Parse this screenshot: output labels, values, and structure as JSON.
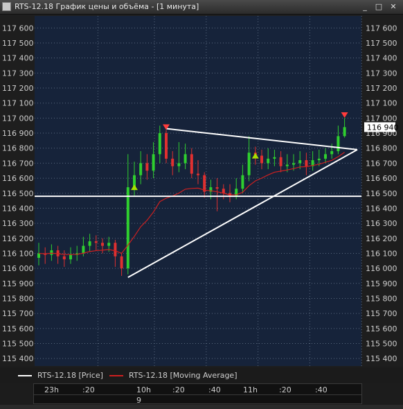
{
  "window": {
    "title": "RTS-12.18 График цены и объёма - [1 минута]",
    "buttons": {
      "minimize": "_",
      "maximize": "□",
      "close": "✕"
    }
  },
  "colors": {
    "background": "#1e1e1e",
    "plot_bg": "#16233a",
    "grid": "#5a6a80",
    "up_bar": "#2fcf2f",
    "down_bar": "#e03030",
    "moving_average": "#d02020",
    "price_line": "#ffffff",
    "up_marker": "#a8e000",
    "down_marker": "#ff3b3b"
  },
  "legend": {
    "price": "RTS-12.18 [Price]",
    "moving_average": "RTS-12.18 [Moving Average]"
  },
  "time_axis": {
    "ticks": [
      "23h",
      ":20",
      "10h",
      ":20",
      ":40",
      "11h",
      ":20",
      ":40"
    ],
    "date": "9"
  },
  "chart_data": {
    "type": "candlestick",
    "title": "",
    "ylim": [
      115350,
      117680
    ],
    "y_ticks": [
      115400,
      115500,
      115600,
      115700,
      115800,
      115900,
      116000,
      116100,
      116200,
      116300,
      116400,
      116500,
      116600,
      116700,
      116800,
      116900,
      117000,
      117100,
      117200,
      117300,
      117400,
      117500,
      117600
    ],
    "y_tick_labels": [
      "115 400",
      "115 500",
      "115 600",
      "115 700",
      "115 800",
      "115 900",
      "116 000",
      "116 100",
      "116 200",
      "116 300",
      "116 400",
      "116 500",
      "116 600",
      "116 700",
      "116 800",
      "116 900",
      "117 000",
      "117 100",
      "117 200",
      "117 300",
      "117 400",
      "117 500",
      "117 600"
    ],
    "last_price": 116940,
    "last_price_label": "116 940",
    "grid": true,
    "horizontal_level": 116480,
    "trendlines": [
      {
        "from": [
          14,
          115940
        ],
        "to": [
          50,
          116790
        ]
      },
      {
        "from": [
          20,
          116930
        ],
        "to": [
          50,
          116790
        ]
      }
    ],
    "up_markers": [
      [
        15,
        116540
      ],
      [
        34,
        116750
      ]
    ],
    "down_markers": [
      [
        20,
        116940
      ],
      [
        48,
        117020
      ]
    ],
    "close": [
      116100,
      116090,
      116120,
      116080,
      116060,
      116090,
      116100,
      116150,
      116180,
      116170,
      116150,
      116170,
      116080,
      116000,
      116540,
      116620,
      116700,
      116650,
      116760,
      116900,
      116730,
      116680,
      116700,
      116760,
      116630,
      116620,
      116510,
      116540,
      116530,
      116500,
      116480,
      116530,
      116620,
      116770,
      116750,
      116700,
      116730,
      116740,
      116680,
      116690,
      116700,
      116720,
      116680,
      116720,
      116730,
      116760,
      116780,
      116880,
      116940
    ],
    "open": [
      116070,
      116100,
      116090,
      116120,
      116080,
      116060,
      116090,
      116100,
      116150,
      116180,
      116170,
      116150,
      116170,
      116080,
      116000,
      116540,
      116620,
      116700,
      116650,
      116760,
      116900,
      116730,
      116680,
      116700,
      116760,
      116630,
      116620,
      116510,
      116540,
      116530,
      116500,
      116480,
      116530,
      116620,
      116770,
      116750,
      116700,
      116730,
      116740,
      116680,
      116690,
      116700,
      116720,
      116680,
      116720,
      116730,
      116760,
      116780,
      116880
    ],
    "high": [
      116170,
      116140,
      116160,
      116150,
      116120,
      116140,
      116150,
      116210,
      116230,
      116220,
      116200,
      116210,
      116190,
      116100,
      116760,
      116710,
      116780,
      116760,
      116840,
      116950,
      116920,
      116780,
      116840,
      116830,
      116800,
      116720,
      116640,
      116590,
      116600,
      116560,
      116560,
      116600,
      116690,
      116880,
      116810,
      116790,
      116800,
      116790,
      116780,
      116760,
      116760,
      116780,
      116770,
      116780,
      116790,
      116800,
      116830,
      116950,
      117000
    ],
    "low": [
      116020,
      116030,
      116050,
      116030,
      116010,
      116030,
      116050,
      116080,
      116110,
      116120,
      116100,
      116110,
      116010,
      115950,
      115960,
      116480,
      116560,
      116590,
      116600,
      116700,
      116700,
      116620,
      116640,
      116660,
      116600,
      116560,
      116470,
      116460,
      116380,
      116460,
      116440,
      116460,
      116500,
      116580,
      116690,
      116660,
      116660,
      116680,
      116640,
      116640,
      116650,
      116660,
      116620,
      116650,
      116680,
      116700,
      116730,
      116760,
      116870
    ],
    "moving_average": [
      116100,
      116097,
      116101,
      116098,
      116092,
      116092,
      116093,
      116101,
      116112,
      116118,
      116121,
      116125,
      116117,
      116100,
      116155,
      116213,
      116277,
      116320,
      116375,
      116444,
      116467,
      116482,
      116501,
      116527,
      116532,
      116534,
      116521,
      116516,
      116510,
      116500,
      116489,
      116490,
      116506,
      116550,
      116582,
      116601,
      116622,
      116640,
      116647,
      116655,
      116664,
      116675,
      116677,
      116685,
      116693,
      116706,
      116719,
      116743,
      116773
    ]
  }
}
